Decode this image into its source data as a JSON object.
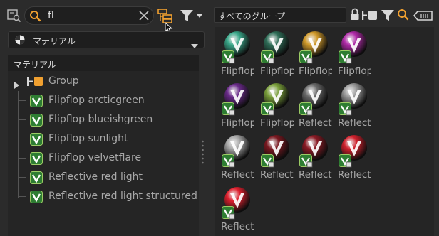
{
  "left": {
    "search": {
      "value": "fl"
    },
    "dropdown": {
      "label": "マテリアル"
    },
    "tree": {
      "header": "マテリアル",
      "group_label": "Group",
      "items": [
        {
          "label": "Flipflop arcticgreen"
        },
        {
          "label": "Flipflop blueishgreen"
        },
        {
          "label": "Flipflop sunlight"
        },
        {
          "label": "Flipflop velvetflare"
        },
        {
          "label": "Reflective red light"
        },
        {
          "label": "Reflective red light structured"
        }
      ]
    }
  },
  "right": {
    "group_box": {
      "label": "すべてのグループ"
    },
    "tiles": [
      {
        "caption": "Flipflop",
        "color": "#3aa88a"
      },
      {
        "caption": "Flipflop",
        "color": "#2f6e58"
      },
      {
        "caption": "Flipflop",
        "color": "#d19a2a"
      },
      {
        "caption": "Flipflop",
        "color": "#b02aa8"
      },
      {
        "caption": "Flipflop",
        "color": "#6a2a8a"
      },
      {
        "caption": "Flipflop",
        "color": "#7aa03a"
      },
      {
        "caption": "Reflect",
        "color": "#6a6a6a"
      },
      {
        "caption": "Reflect",
        "color": "#9a9a9a"
      },
      {
        "caption": "Reflect",
        "color": "#a8a8a8"
      },
      {
        "caption": "Reflect",
        "color": "#7a1820"
      },
      {
        "caption": "Reflect",
        "color": "#8a1a24"
      },
      {
        "caption": "Reflect",
        "color": "#d0202c"
      },
      {
        "caption": "Reflect",
        "color": "#e0202e"
      }
    ]
  },
  "colors": {
    "accent_orange": "#f0a030",
    "check_green": "#4caf50",
    "v_icon_green": "#2e7d32"
  },
  "icons": [
    "library-icon",
    "search-icon",
    "clear-icon",
    "tree-view-icon",
    "filter-icon",
    "material-icon",
    "lock-icon",
    "group-icon",
    "search-icon",
    "tag-icon"
  ]
}
